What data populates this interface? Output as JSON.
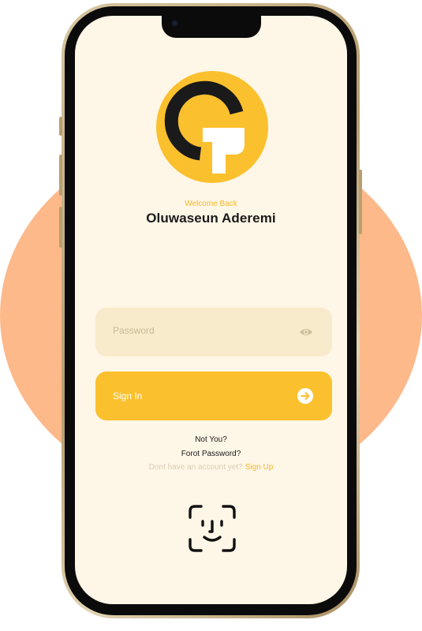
{
  "login": {
    "welcome_text": "Welcome Back",
    "user_name": "Oluwaseun Aderemi",
    "password_placeholder": "Password",
    "sign_in_label": "Sign In",
    "not_you_link": "Not You?",
    "forgot_password_link": "Forot Password?",
    "no_account_text": "Dont have an account yet?",
    "sign_up_link": "Sign Up"
  },
  "icons": {
    "logo": "g-logo-icon",
    "password_visibility": "eye-icon",
    "submit": "arrow-right-icon",
    "biometric": "face-id-icon"
  },
  "colors": {
    "accent": "#FBC02D",
    "screen_background": "#FEF6E6",
    "input_background": "#F8EBCB",
    "backdrop_circle": "#FDB98A"
  }
}
